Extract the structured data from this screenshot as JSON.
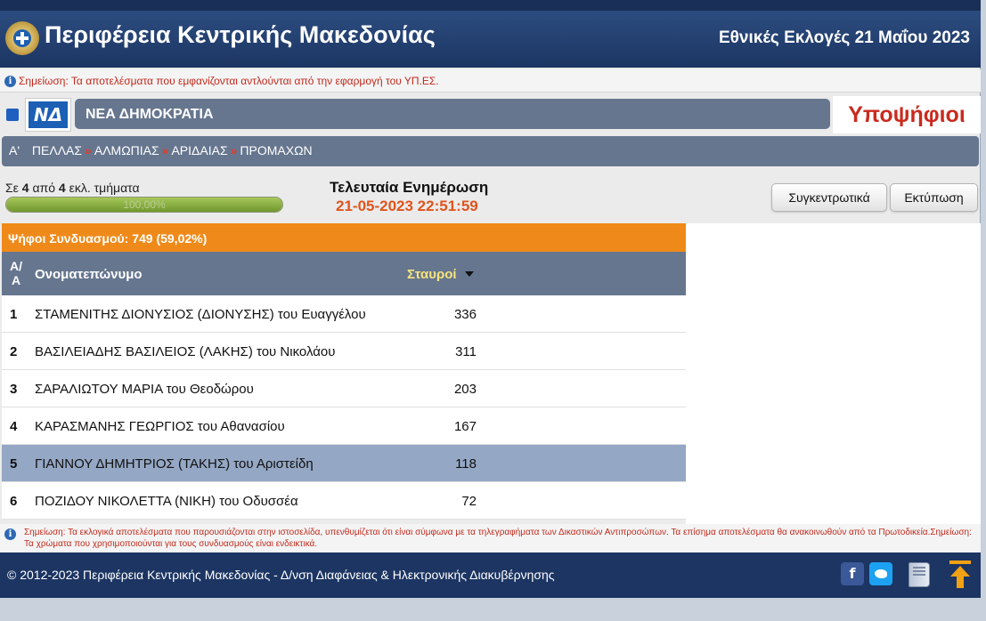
{
  "header": {
    "title": "Περιφέρεια Κεντρικής Μακεδονίας",
    "election": "Εθνικές Εκλογές 21 Μαΐου 2023",
    "emblem_icon": "coat-of-arms-icon"
  },
  "notice": {
    "info_icon": "i",
    "text": "Σημείωση: Τα αποτελέσματα που εμφανίζονται αντλούνται από την εφαρμογή του ΥΠ.ΕΣ."
  },
  "party": {
    "color": "#1f5fc0",
    "logo_text": "ΝΔ",
    "name": "ΝΕΑ ΔΗΜΟΚΡΑΤΙΑ"
  },
  "candidates_heading": "Υποψήφιοι",
  "breadcrumb": {
    "items": [
      "Α'",
      "ΠΕΛΛΑΣ",
      "ΑΛΜΩΠΙΑΣ",
      "ΑΡΙΔΑΙΑΣ",
      "ΠΡΟΜΑΧΩΝ"
    ],
    "separator": "»"
  },
  "progress": {
    "prefix": "Σε",
    "counted": "4",
    "middle": "από",
    "total": "4",
    "suffix": "εκλ. τμήματα",
    "percent_label": "100,00%",
    "fraction": 1.0
  },
  "update": {
    "label": "Τελευταία Ενημέρωση",
    "time": "21-05-2023 22:51:59"
  },
  "buttons": {
    "summary": "Συγκεντρωτικά",
    "print": "Εκτύπωση"
  },
  "votes_bar": "Ψήφοι Συνδυασμού: 749 (59,02%)",
  "table": {
    "col_aa_line1": "Α/",
    "col_aa_line2": "Α",
    "col_name": "Ονοματεπώνυμο",
    "col_votes": "Σταυροί",
    "rows": [
      {
        "rank": "1",
        "name": "ΣΤΑΜΕΝΙΤΗΣ ΔΙΟΝΥΣΙΟΣ (ΔΙΟΝΥΣΗΣ) του Ευαγγέλου",
        "votes": "336"
      },
      {
        "rank": "2",
        "name": "ΒΑΣΙΛΕΙΑΔΗΣ ΒΑΣΙΛΕΙΟΣ (ΛΑΚΗΣ) του Νικολάου",
        "votes": "311"
      },
      {
        "rank": "3",
        "name": "ΣΑΡΑΛΙΩΤΟΥ ΜΑΡΙΑ του Θεοδώρου",
        "votes": "203"
      },
      {
        "rank": "4",
        "name": "ΚΑΡΑΣΜΑΝΗΣ ΓΕΩΡΓΙΟΣ του Αθανασίου",
        "votes": "167"
      },
      {
        "rank": "5",
        "name": "ΓΙΑΝΝΟΥ ΔΗΜΗΤΡΙΟΣ (ΤΑΚΗΣ) του Αριστείδη",
        "votes": "118"
      },
      {
        "rank": "6",
        "name": "ΠΟΖΙΔΟΥ ΝΙΚΟΛΕΤΤΑ (ΝΙΚΗ) του Οδυσσέα",
        "votes": "72"
      }
    ]
  },
  "footnote": "Σημείωση: Τα εκλογικά αποτελέσματα που παρουσιάζονται στην ιστοσελίδα, υπενθυμίζεται ότι είναι σύμφωνα με τα τηλεγραφήματα των Δικαστικών Αντιπροσώπων. Τα επίσημα αποτελέσματα θα ανακοινωθούν από τα Πρωτοδικεία.Σημείωση: Τα χρώματα που χρησιμοποιούνται για τους συνδυασμούς είναι ενδεικτικά.",
  "footer": {
    "copyright": "© 2012-2023 Περιφέρεια Κεντρικής Μακεδονίας - Δ/νση Διαφάνειας & Ηλεκτρονικής Διακυβέρνησης",
    "facebook_glyph": "f"
  }
}
